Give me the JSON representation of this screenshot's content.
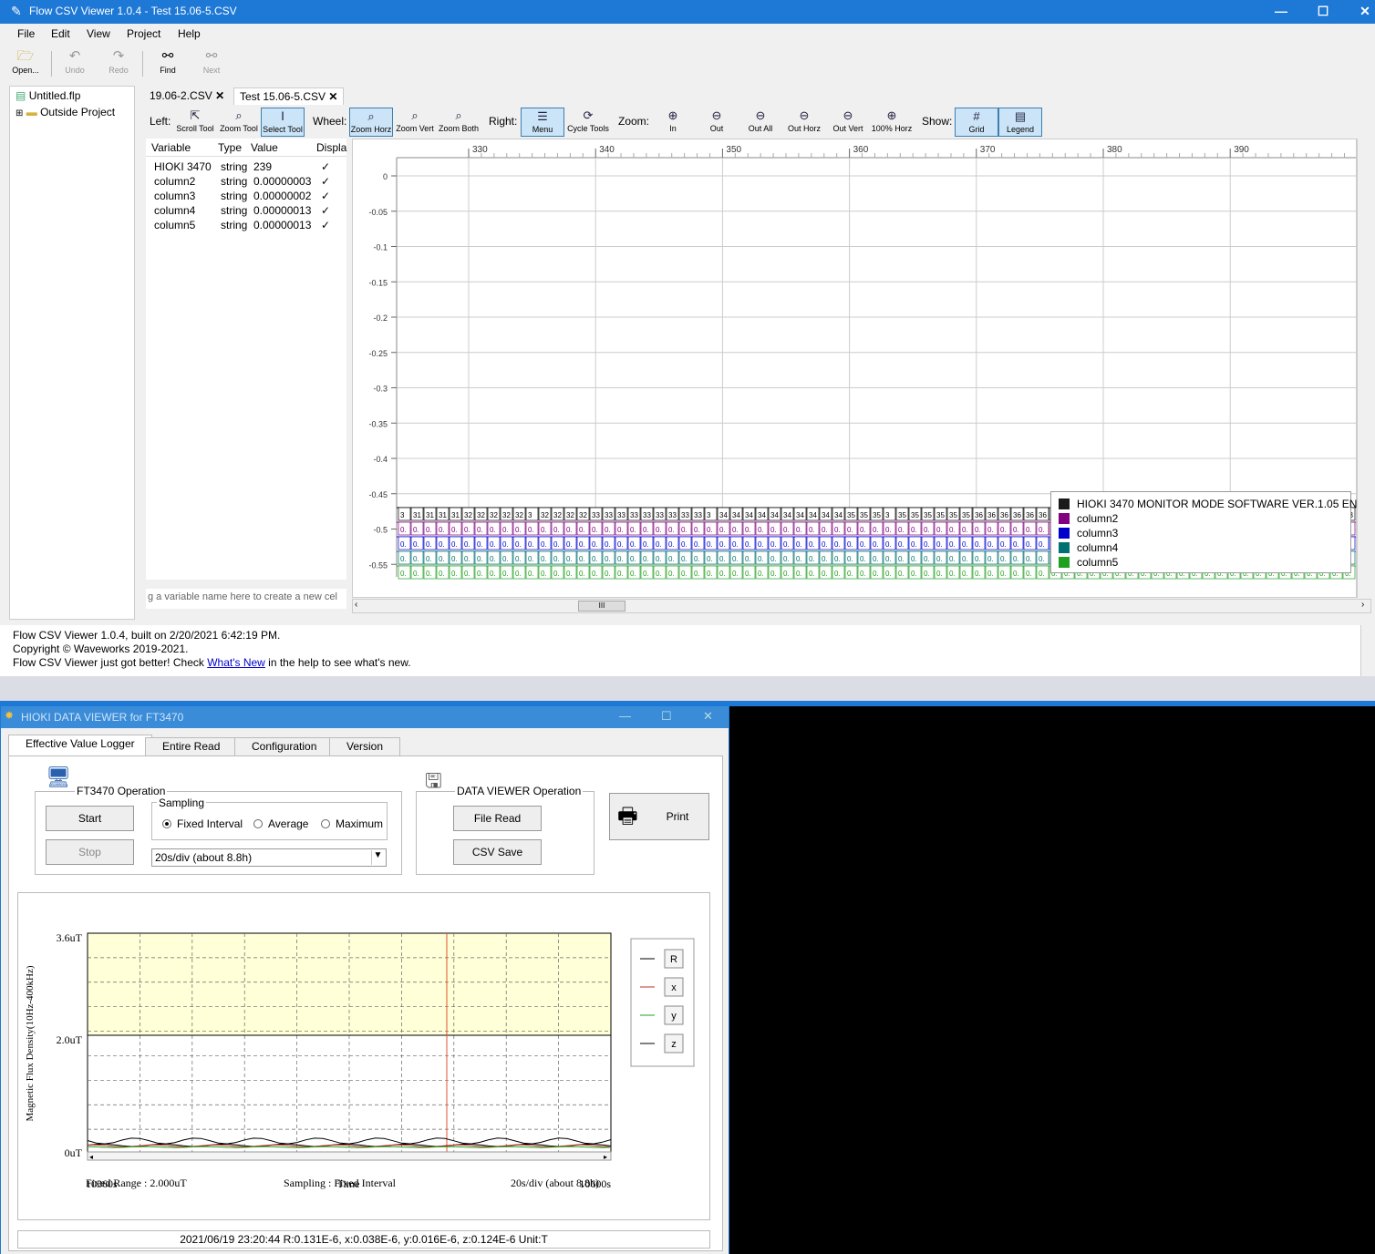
{
  "flow": {
    "title": "Flow CSV Viewer 1.0.4 - Test 15.06-5.CSV",
    "window_buttons": {
      "min": "—",
      "max": "☐",
      "close": "✕"
    },
    "menu": [
      "File",
      "Edit",
      "View",
      "Project",
      "Help"
    ],
    "toolbar": [
      {
        "label": "Open...",
        "icon": "folder-open-icon",
        "enabled": true
      },
      {
        "label": "Undo",
        "icon": "undo-icon",
        "enabled": false
      },
      {
        "label": "Redo",
        "icon": "redo-icon",
        "enabled": false
      },
      {
        "label": "Find",
        "icon": "binoculars-icon",
        "enabled": true
      },
      {
        "label": "Next",
        "icon": "binoculars-next-icon",
        "enabled": false
      }
    ],
    "tree": {
      "file": "Untitled.flp",
      "folder": "Outside Project"
    },
    "tabs": [
      {
        "label": "19.06-2.CSV",
        "active": false
      },
      {
        "label": "Test 15.06-5.CSV",
        "active": true
      }
    ],
    "chart_toolbar": {
      "left_label": "Left:",
      "left": [
        {
          "label": "Scroll Tool",
          "on": false
        },
        {
          "label": "Zoom Tool",
          "on": false
        },
        {
          "label": "Select Tool",
          "on": true
        }
      ],
      "wheel_label": "Wheel:",
      "wheel": [
        {
          "label": "Zoom Horz",
          "on": true
        },
        {
          "label": "Zoom Vert",
          "on": false
        },
        {
          "label": "Zoom Both",
          "on": false
        }
      ],
      "right_label": "Right:",
      "right": [
        {
          "label": "Menu",
          "on": true
        },
        {
          "label": "Cycle Tools",
          "on": false
        }
      ],
      "zoom_label": "Zoom:",
      "zoom": [
        {
          "label": "In"
        },
        {
          "label": "Out"
        },
        {
          "label": "Out All"
        },
        {
          "label": "Out Horz"
        },
        {
          "label": "Out Vert"
        },
        {
          "label": "100% Horz"
        }
      ],
      "show_label": "Show:",
      "show": [
        {
          "label": "Grid",
          "on": true
        },
        {
          "label": "Legend",
          "on": true
        }
      ]
    },
    "var_table": {
      "headers": [
        "Variable",
        "Type",
        "Value",
        "Displa"
      ],
      "rows": [
        {
          "variable": "HIOKI 3470",
          "type": "string",
          "value": "239",
          "display": "✓"
        },
        {
          "variable": "column2",
          "type": "string",
          "value": "0.00000003",
          "display": "✓"
        },
        {
          "variable": "column3",
          "type": "string",
          "value": "0.00000002",
          "display": "✓"
        },
        {
          "variable": "column4",
          "type": "string",
          "value": "0.00000013",
          "display": "✓"
        },
        {
          "variable": "column5",
          "type": "string",
          "value": "0.00000013",
          "display": "✓"
        }
      ],
      "new_var_placeholder": "g a variable name here to create a new cel"
    },
    "legend": [
      {
        "label": "HIOKI 3470 MONITOR MODE SOFTWARE VER.1.05 EN",
        "color": "#1a1a1a"
      },
      {
        "label": "column2",
        "color": "#800080"
      },
      {
        "label": "column3",
        "color": "#0000cc"
      },
      {
        "label": "column4",
        "color": "#007070"
      },
      {
        "label": "column5",
        "color": "#20a020"
      }
    ],
    "status": {
      "line1": "Flow CSV Viewer 1.0.4, built on 2/20/2021 6:42:19 PM.",
      "line2": "Copyright © Waveworks 2019-2021.",
      "line3a": "Flow CSV Viewer just got better! Check ",
      "link": "What's New",
      "line3b": " in the help to see what's new."
    },
    "hscroll_thumb_glyph": "III"
  },
  "chart_data": [
    {
      "type": "line",
      "x_ticks": [
        "330",
        "340",
        "350",
        "360",
        "370",
        "380",
        "390"
      ],
      "y_ticks": [
        "0",
        "-0.05",
        "-0.1",
        "-0.15",
        "-0.2",
        "-0.25",
        "-0.3",
        "-0.35",
        "-0.4",
        "-0.45",
        "-0.5",
        "-0.55"
      ],
      "grid": true,
      "legend_position": "bottom-right",
      "row_labels": {
        "hioki": [
          "3",
          "31",
          "31",
          "31",
          "31",
          "32",
          "32",
          "32",
          "32",
          "32",
          "3",
          "32",
          "32",
          "32",
          "32",
          "33",
          "33",
          "33",
          "33",
          "33",
          "33",
          "33",
          "33",
          "33",
          "3",
          "34",
          "34",
          "34",
          "34",
          "34",
          "34",
          "34",
          "34",
          "34",
          "34",
          "35",
          "35",
          "35",
          "3",
          "35",
          "35",
          "35",
          "35",
          "35",
          "35",
          "36",
          "36",
          "36",
          "36",
          "36",
          "36"
        ],
        "column2": "0.",
        "column3": "0.",
        "column4": "0.",
        "column5": "0.",
        "column3_extra": "0.000",
        "column4_extra": "0.000",
        "column5_extra": "0.000"
      }
    },
    {
      "type": "line",
      "ylabel": "Magnetic Flux Density(10Hz-400kHz)",
      "xlabel": "Time",
      "y_ticks": [
        "3.6uT",
        "2.0uT",
        "0uT"
      ],
      "x_start": "10360s",
      "x_end": "10600s",
      "series": [
        {
          "name": "R",
          "color": "#000000",
          "level_uT": 0.05
        },
        {
          "name": "x",
          "color": "#c03020",
          "level_uT": 0.04
        },
        {
          "name": "y",
          "color": "#20a020",
          "level_uT": 0.02
        },
        {
          "name": "z",
          "color": "#000000",
          "level_uT": 0.12
        }
      ],
      "band_color": "#ffffd8",
      "cursor_color": "#e05030"
    }
  ],
  "hioki": {
    "title": "HIOKI DATA VIEWER for FT3470",
    "window_buttons": {
      "min": "—",
      "max": "☐",
      "close": "✕"
    },
    "tabs": [
      {
        "label": "Effective Value Logger",
        "active": true
      },
      {
        "label": "Entire Read",
        "active": false
      },
      {
        "label": "Configuration",
        "active": false
      },
      {
        "label": "Version",
        "active": false
      }
    ],
    "op_group": "FT3470 Operation",
    "start": "Start",
    "stop": "Stop",
    "sampling_group": "Sampling",
    "radios": [
      {
        "label": "Fixed Interval",
        "checked": true
      },
      {
        "label": "Average",
        "checked": false
      },
      {
        "label": "Maximum",
        "checked": false
      }
    ],
    "rate_select": "20s/div (about 8.8h)",
    "viewer_group": "DATA VIEWER Operation",
    "file_read": "File Read",
    "csv_save": "CSV Save",
    "print": "Print",
    "footer": {
      "fixed_range": "Fixed Range : 2.000uT",
      "sampling": "Sampling : Fixed Interval",
      "rate": "20s/div (about 8.8h)"
    },
    "status": "2021/06/19  23:20:44   R:0.131E-6, x:0.038E-6, y:0.016E-6, z:0.124E-6   Unit:T"
  }
}
